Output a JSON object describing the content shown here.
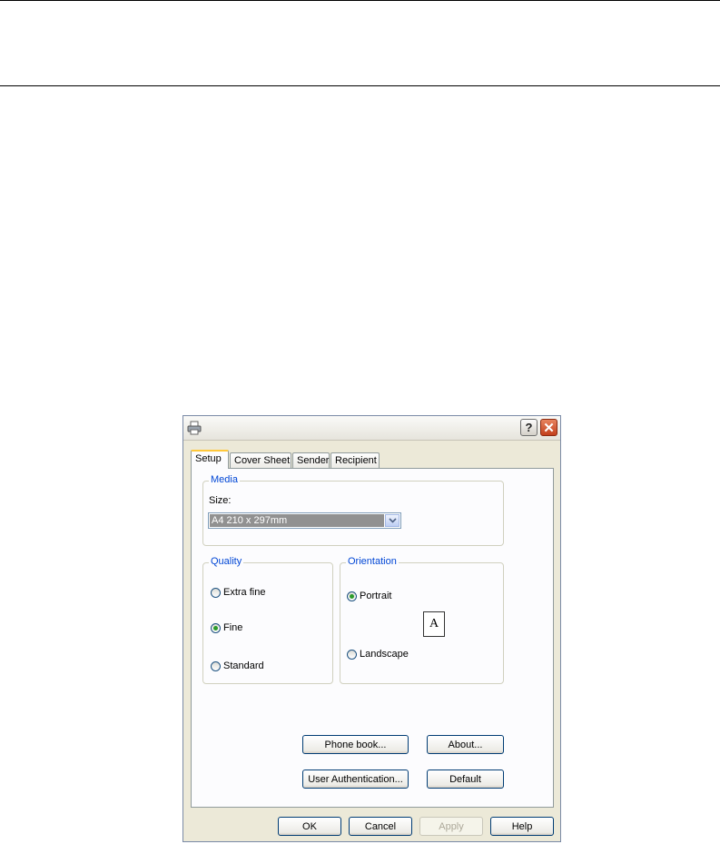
{
  "dialog": {
    "icons": {
      "app": "printer-icon",
      "help": "help-icon",
      "close": "close-icon"
    },
    "help_glyph": "?",
    "close_glyph": "✕"
  },
  "tabs": [
    {
      "label": "Setup",
      "active": true
    },
    {
      "label": "Cover Sheet"
    },
    {
      "label": "Sender"
    },
    {
      "label": "Recipient"
    }
  ],
  "media": {
    "legend": "Media",
    "size_label": "Size:",
    "size_value": "A4 210 x 297mm"
  },
  "quality": {
    "legend": "Quality",
    "options": [
      {
        "label": "Extra fine",
        "selected": false
      },
      {
        "label": "Fine",
        "selected": true
      },
      {
        "label": "Standard",
        "selected": false
      }
    ]
  },
  "orientation": {
    "legend": "Orientation",
    "portrait_label": "Portrait",
    "landscape_label": "Landscape",
    "selected": "portrait",
    "preview_letter": "A"
  },
  "buttons": {
    "phone_book": "Phone book...",
    "about": "About...",
    "user_auth": "User Authentication...",
    "default": "Default",
    "ok": "OK",
    "cancel": "Cancel",
    "apply": "Apply",
    "help": "Help"
  },
  "colors": {
    "legend_text": "#0046d5",
    "radio_dot": "#2b9b2b",
    "dialog_bg": "#ece9d8"
  }
}
